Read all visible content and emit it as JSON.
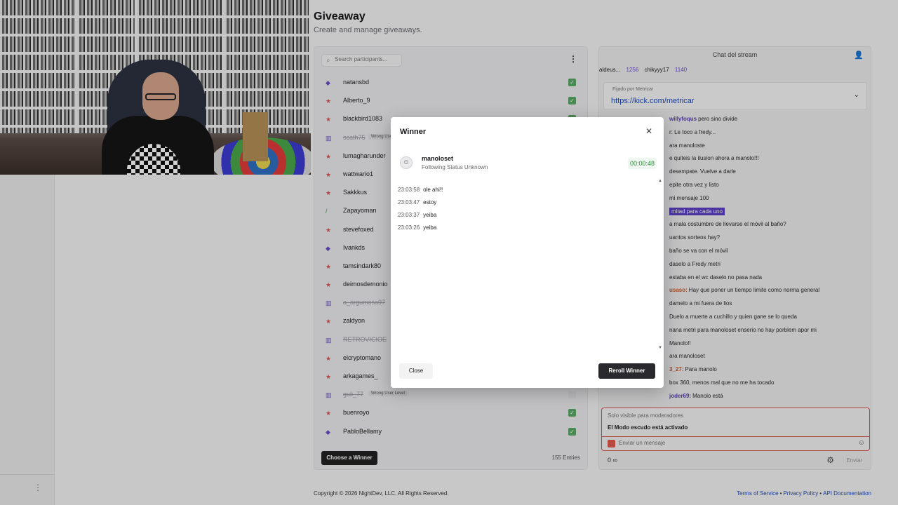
{
  "page": {
    "title": "Giveaway",
    "subtitle": "Create and manage giveaways."
  },
  "participants_panel": {
    "search_placeholder": "Search participants...",
    "choose_winner_label": "Choose a Winner",
    "entries_label": "155 Entries",
    "rows": [
      {
        "name": "natansbd",
        "icon": "gem-icon",
        "color": "#6b4cc8",
        "muted": false,
        "checked": true,
        "tag": ""
      },
      {
        "name": "Alberto_9",
        "icon": "star-icon",
        "color": "#d9534f",
        "muted": false,
        "checked": true,
        "tag": ""
      },
      {
        "name": "blackbird1083",
        "icon": "star-icon",
        "color": "#d9534f",
        "muted": false,
        "checked": true,
        "tag": ""
      },
      {
        "name": "scath75",
        "icon": "bars-icon",
        "color": "#6b4cc8",
        "muted": true,
        "checked": false,
        "tag": "Wrong User Level"
      },
      {
        "name": "lumagharunder",
        "icon": "star-icon",
        "color": "#d9534f",
        "muted": false,
        "checked": true,
        "tag": ""
      },
      {
        "name": "wattwario1",
        "icon": "star-icon",
        "color": "#d9534f",
        "muted": false,
        "checked": true,
        "tag": ""
      },
      {
        "name": "Sakkkus",
        "icon": "star-icon",
        "color": "#d9534f",
        "muted": false,
        "checked": true,
        "tag": ""
      },
      {
        "name": "Zapayoman",
        "icon": "sword-icon",
        "color": "#3aa04a",
        "muted": false,
        "checked": true,
        "tag": ""
      },
      {
        "name": "stevefoxed",
        "icon": "star-icon",
        "color": "#d9534f",
        "muted": false,
        "checked": true,
        "tag": ""
      },
      {
        "name": "Ivankds",
        "icon": "gem-icon",
        "color": "#6b4cc8",
        "muted": false,
        "checked": true,
        "tag": ""
      },
      {
        "name": "tamsindark80",
        "icon": "star-icon",
        "color": "#d9534f",
        "muted": false,
        "checked": true,
        "tag": ""
      },
      {
        "name": "deimosdemonio",
        "icon": "star-icon",
        "color": "#d9534f",
        "muted": false,
        "checked": true,
        "tag": ""
      },
      {
        "name": "a_argumosa97",
        "icon": "bars-icon",
        "color": "#6b4cc8",
        "muted": true,
        "checked": false,
        "tag": ""
      },
      {
        "name": "zaldyon",
        "icon": "star-icon",
        "color": "#d9534f",
        "muted": false,
        "checked": true,
        "tag": ""
      },
      {
        "name": "RETROVICIOE",
        "icon": "bars-icon",
        "color": "#6b4cc8",
        "muted": true,
        "checked": false,
        "tag": ""
      },
      {
        "name": "elcryptomano",
        "icon": "star-icon",
        "color": "#d9534f",
        "muted": false,
        "checked": true,
        "tag": ""
      },
      {
        "name": "arkagames_",
        "icon": "star-icon",
        "color": "#d9534f",
        "muted": false,
        "checked": true,
        "tag": ""
      },
      {
        "name": "guli_77",
        "icon": "bars-icon",
        "color": "#6b4cc8",
        "muted": true,
        "checked": false,
        "tag": "Wrong User Level"
      },
      {
        "name": "buenroyo",
        "icon": "star-icon",
        "color": "#d9534f",
        "muted": false,
        "checked": true,
        "tag": ""
      },
      {
        "name": "PabloBellamy",
        "icon": "gem-icon",
        "color": "#6b4cc8",
        "muted": false,
        "checked": true,
        "tag": ""
      }
    ]
  },
  "chat": {
    "title": "Chat del stream",
    "gifters": [
      "aldeus...",
      "1256",
      "chikyyy17",
      "1140"
    ],
    "pinned_meta": "Fijado por  Metricar",
    "pinned_link": "https://kick.com/metricar",
    "messages": [
      {
        "user": "willyfoqus",
        "user_color": "purple",
        "text": "pero sino divide",
        "highlight": ""
      },
      {
        "user": "",
        "user_color": "",
        "text": "r: Le toco a fredy...",
        "highlight": ""
      },
      {
        "user": "",
        "user_color": "",
        "text": "ara manoloste",
        "highlight": ""
      },
      {
        "user": "",
        "user_color": "",
        "text": "e quiteis la ilusion ahora a manolo!!!",
        "highlight": ""
      },
      {
        "user": "",
        "user_color": "",
        "text": "desempate. Vuelve a darle",
        "highlight": ""
      },
      {
        "user": "",
        "user_color": "",
        "text": "epite otra vez y listo",
        "highlight": ""
      },
      {
        "user": "",
        "user_color": "",
        "text": "mi mensaje 100",
        "highlight": ""
      },
      {
        "user": "",
        "user_color": "",
        "text": "",
        "highlight": "mitad para cada uno"
      },
      {
        "user": "",
        "user_color": "",
        "text": "a mala costumbre de llevarse el móvil al baño?",
        "highlight": ""
      },
      {
        "user": "",
        "user_color": "",
        "text": "uantos sorteos hay?",
        "highlight": ""
      },
      {
        "user": "",
        "user_color": "",
        "text": "baño se va con el móvil",
        "highlight": ""
      },
      {
        "user": "",
        "user_color": "",
        "text": "daselo a Fredy metri",
        "highlight": ""
      },
      {
        "user": "",
        "user_color": "",
        "text": "estaba en el wc daselo no pasa nada",
        "highlight": ""
      },
      {
        "user": "usaso:",
        "user_color": "orange",
        "text": "Hay que poner un tiempo limite como norma general",
        "highlight": ""
      },
      {
        "user": "",
        "user_color": "",
        "text": "damelo a mi fuera de lios",
        "highlight": ""
      },
      {
        "user": "",
        "user_color": "",
        "text": "Duelo a muerte a cuchillo y quien gane se lo queda",
        "highlight": ""
      },
      {
        "user": "",
        "user_color": "",
        "text": "nana metri para manoloset enserio no hay porblem apor mi",
        "highlight": ""
      },
      {
        "user": "",
        "user_color": "",
        "text": "Manolo!!",
        "highlight": ""
      },
      {
        "user": "",
        "user_color": "",
        "text": "ara manoloset",
        "highlight": ""
      },
      {
        "user": "3_27:",
        "user_color": "orange",
        "text": "Para manolo",
        "highlight": ""
      },
      {
        "user": "",
        "user_color": "",
        "text": "box 360, menos mal que no me ha tocado",
        "highlight": ""
      },
      {
        "user": "joder69:",
        "user_color": "purple",
        "text": "Manolo está",
        "highlight": ""
      }
    ],
    "mod_visible_text": "Solo visible para moderadores",
    "shield_text": "El Modo escudo está activado",
    "input_placeholder": "Enviar un mensaje",
    "footer_count": "0",
    "footer_infinity": "∞",
    "send_label": "Enviar"
  },
  "footer": {
    "copyright": "Copyright © 2026 NightDev, LLC. All Rights Reserved.",
    "links": [
      "Terms of Service",
      "Privacy Policy",
      "API Documentation"
    ]
  },
  "modal": {
    "title": "Winner",
    "winner_name": "manoloset",
    "winner_status": "Following Status Unknown",
    "timer": "00:00:48",
    "log": [
      {
        "time": "23:03:58",
        "text": "ole ahi!!"
      },
      {
        "time": "23:03:47",
        "text": "estoy"
      },
      {
        "time": "23:03:37",
        "text": "yeiba"
      },
      {
        "time": "23:03:26",
        "text": "yeiba"
      }
    ],
    "close_label": "Close",
    "reroll_label": "Reroll Winner"
  }
}
